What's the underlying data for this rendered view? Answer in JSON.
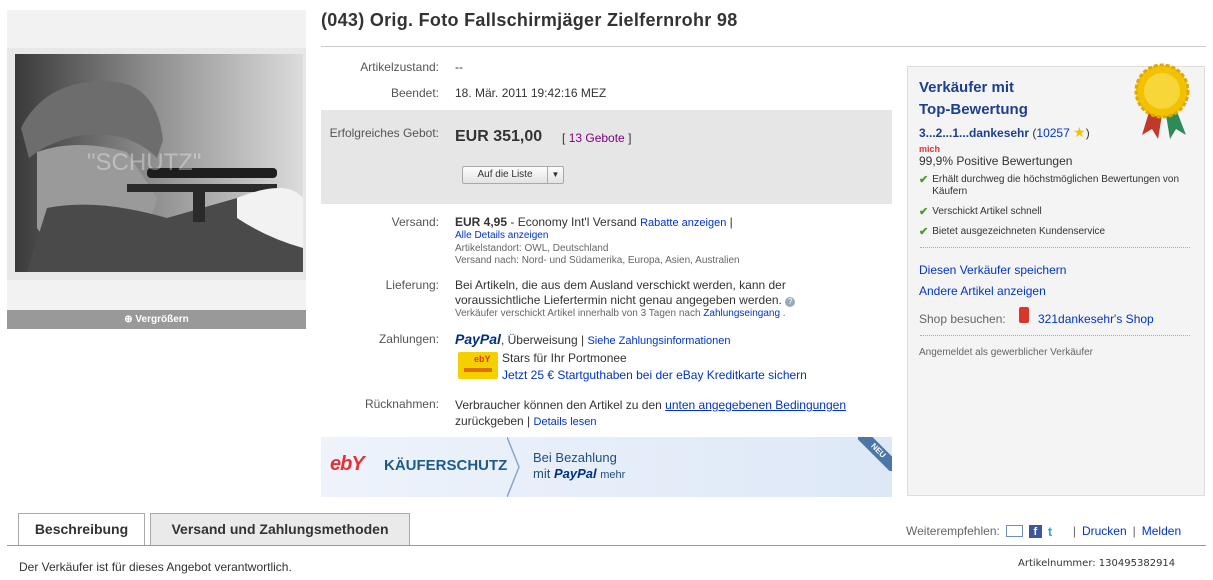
{
  "title": "(043) Orig. Foto Fallschirmjäger Zielfernrohr 98",
  "photo": {
    "watermark": "\"SCHUTZ\"",
    "enlarge_label": "Vergrößern"
  },
  "details": {
    "condition_label": "Artikelzustand:",
    "condition_value": "--",
    "ended_label": "Beendet:",
    "ended_value": "18. Mär. 2011 19:42:16 MEZ",
    "bid_label": "Erfolgreiches Gebot:",
    "bid_value": "EUR 351,00",
    "bids_open": "[",
    "bids_count": "13 Gebote",
    "bids_close": "]",
    "watch_button": "Auf die Liste",
    "shipping_label": "Versand:",
    "shipping_price": "EUR 4,95",
    "shipping_method": "- Economy Int'l Versand",
    "discounts_link": "Rabatte anzeigen",
    "all_details_link": "Alle Details anzeigen",
    "location": "Artikelstandort: OWL, Deutschland",
    "ships_to": "Versand nach: Nord- und Südamerika, Europa, Asien, Australien",
    "delivery_label": "Lieferung:",
    "delivery_text": "Bei Artikeln, die aus dem Ausland verschickt werden, kann der voraussichtliche Liefertermin nicht genau angegeben werden.",
    "delivery_note": "Verkäufer verschickt Artikel innerhalb von 3 Tagen nach",
    "payment_received_link": "Zahlungseingang",
    "payments_label": "Zahlungen:",
    "paypal": "PayPal",
    "transfer": ", Überweisung |",
    "payment_info_link": "Siehe Zahlungsinformationen",
    "stars_text": "Stars für Ihr Portmonee",
    "credit_link": "Jetzt 25 € Startguthaben bei der eBay Kreditkarte sichern",
    "returns_label": "Rücknahmen:",
    "returns_text": "Verbraucher können den Artikel zu den",
    "returns_link": "unten angegebenen Bedingungen",
    "returns_text2": "zurückgeben |",
    "returns_details_link": "Details lesen"
  },
  "banner": {
    "ebay": "ebY",
    "title": "KÄUFERSCHUTZ",
    "line1": "Bei Bezahlung",
    "line2_prefix": "mit",
    "paypal": "PayPal",
    "more": "mehr",
    "ribbon": "NEU"
  },
  "seller": {
    "heading1": "Verkäufer mit",
    "heading2": "Top-Bewertung",
    "name": "3...2...1...dankesehr",
    "open": "(",
    "feedback_count": "10257",
    "close": ")",
    "me_badge": "mich",
    "positive": "99,9% Positive Bewertungen",
    "features": [
      "Erhält durchweg die höchstmöglichen Bewertungen von Käufern",
      "Verschickt Artikel schnell",
      "Bietet ausgezeichneten Kundenservice"
    ],
    "save_link": "Diesen Verkäufer speichern",
    "other_items_link": "Andere Artikel anzeigen",
    "shop_label": "Shop besuchen:",
    "shop_link": "321dankesehr's Shop",
    "registered": "Angemeldet als gewerblicher Verkäufer"
  },
  "tabs": [
    {
      "label": "Beschreibung"
    },
    {
      "label": "Versand und Zahlungsmethoden"
    }
  ],
  "footer": {
    "share_label": "Weiterempfehlen:",
    "sep1": "|",
    "print": "Drucken",
    "sep2": "|",
    "report": "Melden",
    "responsible": "Der Verkäufer ist für dieses Angebot verantwortlich.",
    "item_number": "Artikelnummer: 130495382914"
  }
}
